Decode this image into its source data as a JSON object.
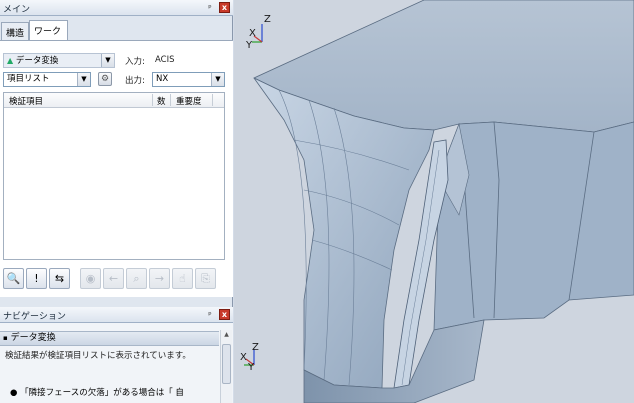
{
  "main_panel": {
    "title": "メイン",
    "pin_glyph": "ᵖ",
    "close_glyph": "x",
    "tabs": [
      {
        "label": "構造",
        "active": false
      },
      {
        "label": "ワーク",
        "active": true
      }
    ]
  },
  "work": {
    "mode_select": {
      "icon": "translate-icon",
      "value": "データ変換"
    },
    "input_label": "入力:",
    "input_value": "ACIS",
    "list_select": {
      "value": "項目リスト"
    },
    "output_label": "出力:",
    "output_value": "NX",
    "table": {
      "columns": [
        "検証項目",
        "数",
        "重要度"
      ],
      "rows": []
    },
    "toolbar": [
      {
        "name": "search-icon",
        "glyph": "🔍",
        "enabled": true
      },
      {
        "name": "highlight-icon",
        "glyph": "!",
        "enabled": true
      },
      {
        "name": "transfer-icon",
        "glyph": "⇆",
        "enabled": true
      },
      {
        "name": "pin-icon",
        "glyph": "◉",
        "enabled": false
      },
      {
        "name": "back-icon",
        "glyph": "←",
        "enabled": false
      },
      {
        "name": "zoom-icon",
        "glyph": "⌕",
        "enabled": false
      },
      {
        "name": "forward-icon",
        "glyph": "→",
        "enabled": false
      },
      {
        "name": "hand-icon",
        "glyph": "☝",
        "enabled": false
      },
      {
        "name": "export-icon",
        "glyph": "⎘",
        "enabled": false
      }
    ]
  },
  "navigation": {
    "title": "ナビゲーション",
    "section_title": "データ変換",
    "description": "検証結果が検証項目リストに表示されています。",
    "bullet": "「隣接フェースの欠落」がある場合は「  自"
  },
  "viewport": {
    "axes_top": {
      "x": "X",
      "y": "Y",
      "z": "Z"
    },
    "axes_bottom": {
      "x": "X",
      "y": "Y",
      "z": "Z"
    }
  },
  "colors": {
    "accent": "#c83a2a",
    "panel_bg": "#dfe6ef",
    "model_face": "#9fb2c8",
    "axis_x": "#c43a3a",
    "axis_y": "#2ca02c",
    "axis_z": "#2a4bd1"
  }
}
